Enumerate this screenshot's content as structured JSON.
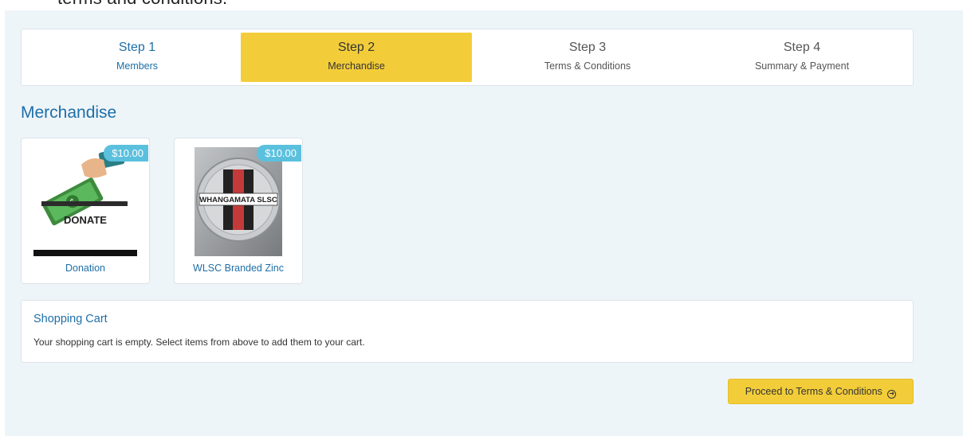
{
  "page": {
    "cut_text": "terms and conditions."
  },
  "steps": [
    {
      "num": "Step 1",
      "label": "Members"
    },
    {
      "num": "Step 2",
      "label": "Merchandise"
    },
    {
      "num": "Step 3",
      "label": "Terms & Conditions"
    },
    {
      "num": "Step 4",
      "label": "Summary & Payment"
    }
  ],
  "merchandise": {
    "title": "Merchandise",
    "items": [
      {
        "name": "Donation",
        "price": "$10.00",
        "image_text": "DONATE",
        "icon": "donate-hand-money-icon"
      },
      {
        "name": "WLSC Branded Zinc",
        "price": "$10.00",
        "image_text": "WHANGAMATA SLSC",
        "icon": "zinc-tin-icon"
      }
    ]
  },
  "cart": {
    "title": "Shopping Cart",
    "message": "Your shopping cart is empty. Select items from above to add them to your cart."
  },
  "actions": {
    "proceed_label": "Proceed to Terms & Conditions",
    "proceed_icon": "arrow-circle-right-icon"
  },
  "colors": {
    "accent": "#f3cd39",
    "link": "#1e6fa8",
    "badge": "#5bc0de",
    "panel_bg": "#eef5f9"
  }
}
